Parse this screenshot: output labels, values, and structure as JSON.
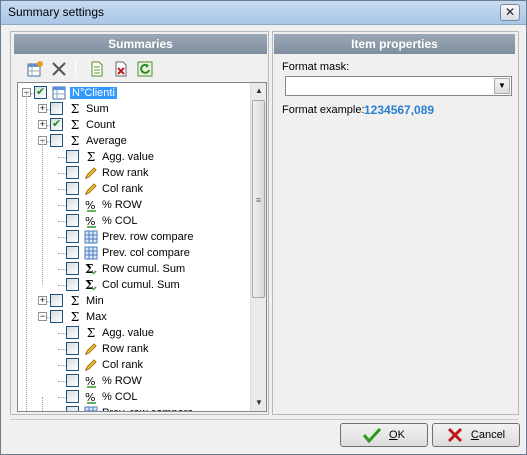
{
  "window": {
    "title": "Summary settings",
    "close_glyph": "✕"
  },
  "left_panel": {
    "header": "Summaries",
    "toolbar": [
      {
        "name": "add-summary-icon",
        "glyph": "▦"
      },
      {
        "name": "delete-summary-icon",
        "glyph": "✕"
      },
      {
        "name": "document-icon",
        "glyph": "▤"
      },
      {
        "name": "remove-document-icon",
        "glyph": "▣"
      },
      {
        "name": "refresh-icon",
        "glyph": "⟳"
      }
    ]
  },
  "tree": {
    "items": [
      {
        "label": "N°Clienti",
        "level": 0,
        "checked": true,
        "expander": "-",
        "icon": "table-icon",
        "selected": true
      },
      {
        "label": "Sum",
        "level": 1,
        "checked": false,
        "expander": "+",
        "icon": "sigma-icon"
      },
      {
        "label": "Count",
        "level": 1,
        "checked": true,
        "expander": "+",
        "icon": "sigma-icon"
      },
      {
        "label": "Average",
        "level": 1,
        "checked": false,
        "expander": "-",
        "icon": "sigma-icon"
      },
      {
        "label": "Agg. value",
        "level": 2,
        "checked": false,
        "icon": "sigma-icon"
      },
      {
        "label": "Row rank",
        "level": 2,
        "checked": false,
        "icon": "pencil-icon"
      },
      {
        "label": "Col rank",
        "level": 2,
        "checked": false,
        "icon": "pencil-icon"
      },
      {
        "label": "% ROW",
        "level": 2,
        "checked": false,
        "icon": "percent-icon"
      },
      {
        "label": "% COL",
        "level": 2,
        "checked": false,
        "icon": "percent-icon"
      },
      {
        "label": "Prev. row compare",
        "level": 2,
        "checked": false,
        "icon": "grid-icon"
      },
      {
        "label": "Prev. col compare",
        "level": 2,
        "checked": false,
        "icon": "grid-icon"
      },
      {
        "label": "Row cumul. Sum",
        "level": 2,
        "checked": false,
        "icon": "cumul-sigma-icon"
      },
      {
        "label": "Col cumul. Sum",
        "level": 2,
        "checked": false,
        "icon": "cumul-sigma-icon"
      },
      {
        "label": "Min",
        "level": 1,
        "checked": false,
        "expander": "+",
        "icon": "sigma-icon"
      },
      {
        "label": "Max",
        "level": 1,
        "checked": false,
        "expander": "-",
        "icon": "sigma-icon"
      },
      {
        "label": "Agg. value",
        "level": 2,
        "checked": false,
        "icon": "sigma-icon"
      },
      {
        "label": "Row rank",
        "level": 2,
        "checked": false,
        "icon": "pencil-icon"
      },
      {
        "label": "Col rank",
        "level": 2,
        "checked": false,
        "icon": "pencil-icon"
      },
      {
        "label": "% ROW",
        "level": 2,
        "checked": false,
        "icon": "percent-icon"
      },
      {
        "label": "% COL",
        "level": 2,
        "checked": false,
        "icon": "percent-icon"
      },
      {
        "label": "Prev. row compare",
        "level": 2,
        "checked": false,
        "icon": "grid-icon"
      }
    ]
  },
  "right_panel": {
    "header": "Item properties",
    "format_mask_label": "Format mask:",
    "format_mask_value": "",
    "format_example_label": "Format example:",
    "format_example_value": "1234567,089"
  },
  "buttons": {
    "ok_label": "OK",
    "cancel_label": "Cancel"
  },
  "colors": {
    "header_bg": "#8a98a8",
    "selected": "#3399ff",
    "example_value": "#2b7fd0",
    "ok_check": "#2a9a1e",
    "cancel_x": "#c01818"
  }
}
